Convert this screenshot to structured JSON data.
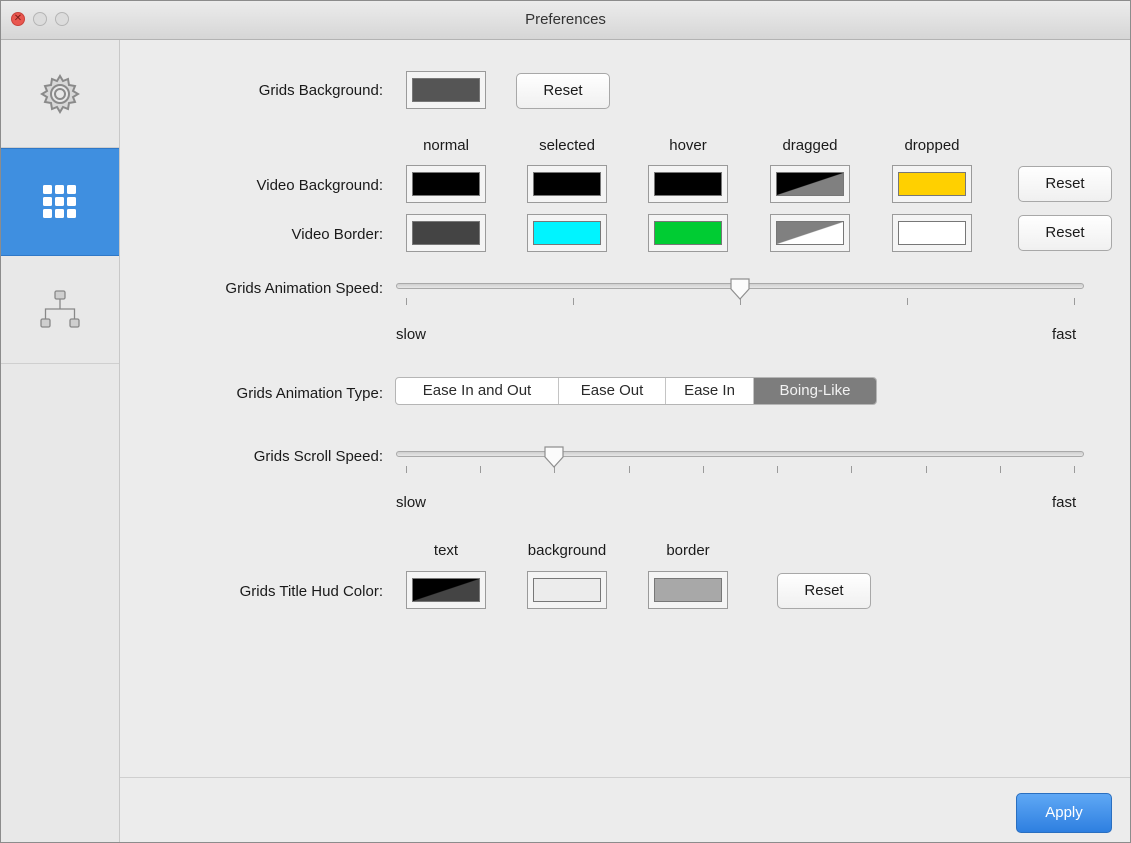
{
  "window": {
    "title": "Preferences"
  },
  "sidebar": {
    "items": [
      {
        "icon": "gear-icon",
        "selected": false
      },
      {
        "icon": "grid-icon",
        "selected": true
      },
      {
        "icon": "hierarchy-icon",
        "selected": false
      }
    ]
  },
  "grids_background": {
    "label": "Grids Background:",
    "color": "#555555",
    "reset_label": "Reset"
  },
  "video": {
    "columns": [
      "normal",
      "selected",
      "hover",
      "dragged",
      "dropped"
    ],
    "background": {
      "label": "Video Background:",
      "colors": [
        "#000000",
        "#000000",
        "#000000",
        "diagonal:#000000/#808080",
        "#ffd000"
      ],
      "reset_label": "Reset"
    },
    "border": {
      "label": "Video Border:",
      "colors": [
        "#444444",
        "#00f4ff",
        "#00cc33",
        "diagonal:#808080/#ffffff",
        "#ffffff"
      ],
      "reset_label": "Reset"
    }
  },
  "animation_speed": {
    "label": "Grids Animation Speed:",
    "min_label": "slow",
    "max_label": "fast",
    "value": 0.5,
    "tick_count": 5
  },
  "animation_type": {
    "label": "Grids Animation Type:",
    "options": [
      "Ease In and Out",
      "Ease Out",
      "Ease In",
      "Boing-Like"
    ],
    "selected": "Boing-Like"
  },
  "scroll_speed": {
    "label": "Grids Scroll Speed:",
    "min_label": "slow",
    "max_label": "fast",
    "value": 0.222,
    "tick_count": 10
  },
  "title_hud": {
    "label": "Grids Title Hud Color:",
    "columns": [
      "text",
      "background",
      "border"
    ],
    "colors": [
      "diagonal:#000000/#444444",
      "#ececec",
      "#a8a8a8"
    ],
    "reset_label": "Reset"
  },
  "footer": {
    "apply_label": "Apply"
  },
  "theme": {
    "accent": "#3f8fe0",
    "apply_button": "#2e7fe0"
  }
}
